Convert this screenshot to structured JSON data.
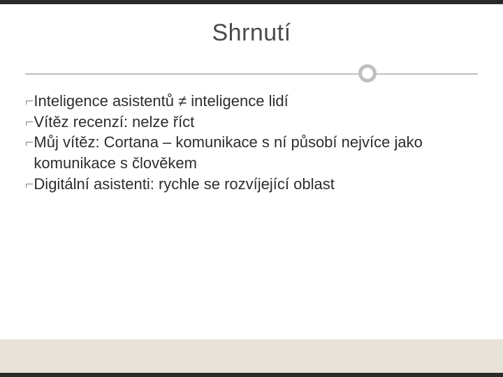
{
  "title": "Shrnutí",
  "bullet_glyph": "⌐",
  "bullets": [
    "Inteligence asistentů ≠ inteligence lidí",
    "Vítěz recenzí: nelze říct",
    "Můj vítěz: Cortana – komunikace s ní působí nejvíce jako komunikace s člověkem",
    "Digitální asistenti: rychle se rozvíjející oblast"
  ]
}
